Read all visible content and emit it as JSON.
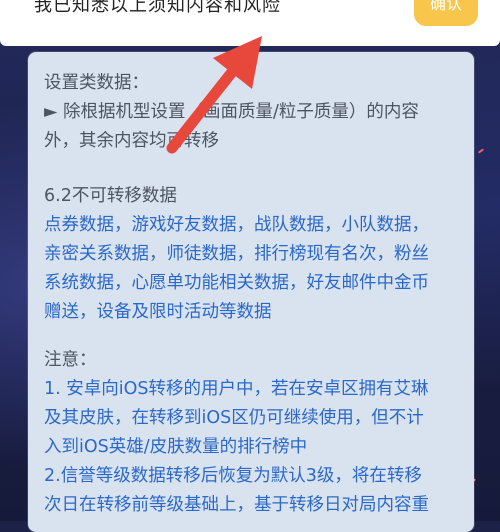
{
  "top_bar": {
    "label": "我已知悉以上须知内容和风险",
    "confirm_label": "确认"
  },
  "settings_section": {
    "heading": "设置类数据：",
    "lines": [
      "► 除根据机型设置（画面质量/粒子质量）的内容",
      "外，其余内容均可转移"
    ]
  },
  "non_transferable": {
    "heading": "6.2不可转移数据",
    "lines": [
      "点券数据，游戏好友数据，战队数据，小队数据，",
      "亲密关系数据，师徒数据，排行榜现有名次，粉丝",
      "系统数据，心愿单功能相关数据，好友邮件中金币",
      "赠送，设备及限时活动等数据"
    ]
  },
  "notes": {
    "heading": "注意：",
    "lines": [
      "1. 安卓向iOS转移的用户中，若在安卓区拥有艾琳",
      "及其皮肤，在转移到iOS区仍可继续使用，但不计",
      "入到iOS英雄/皮肤数量的排行榜中",
      "2.信誉等级数据转移后恢复为默认3级，将在转移",
      "次日在转移前等级基础上，基于转移日对局内容重"
    ]
  },
  "colors": {
    "background": "#1c2147",
    "panel": "#d9e2ef",
    "link_blue": "#2b69c9",
    "confirm_button": "#f7c64a",
    "annotation_arrow": "#e8473c"
  },
  "icons": {
    "annotation": "red-arrow-icon"
  }
}
